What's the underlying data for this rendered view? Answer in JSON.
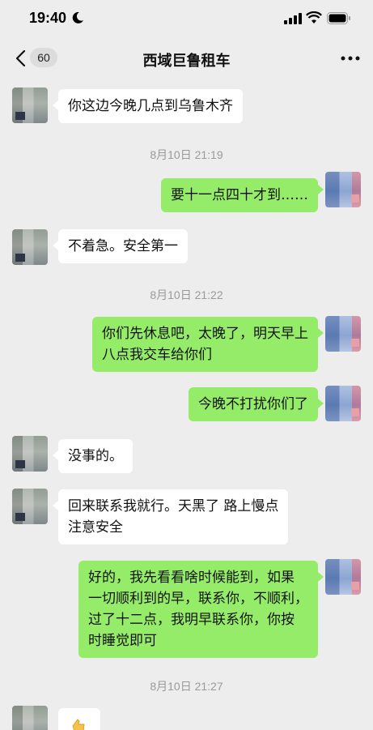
{
  "status_bar": {
    "time": "19:40",
    "icons": [
      "moon-icon",
      "signal-icon",
      "wifi-icon",
      "battery-icon"
    ]
  },
  "nav": {
    "back_icon": "chevron-left-icon",
    "unread_count": "60",
    "title": "西域巨鲁租车",
    "more_icon": "ellipsis-icon"
  },
  "colors": {
    "background": "#ededed",
    "sent_bubble": "#95ec69",
    "received_bubble": "#ffffff",
    "timestamp_text": "#9a9a9a"
  },
  "messages": [
    {
      "side": "left",
      "text": "你这边今晚几点到乌鲁木齐"
    },
    {
      "side": "timestamp",
      "text": "8月10日 21:19"
    },
    {
      "side": "right",
      "text": "要十一点四十才到……"
    },
    {
      "side": "left",
      "text": "不着急。安全第一"
    },
    {
      "side": "timestamp",
      "text": "8月10日 21:22"
    },
    {
      "side": "right",
      "text": "你们先休息吧，太晚了，明天早上\n八点我交车给你们"
    },
    {
      "side": "right",
      "text": "今晚不打扰你们了"
    },
    {
      "side": "left",
      "text": "没事的。"
    },
    {
      "side": "left",
      "text": "回来联系我就行。天黑了 路上慢点\n注意安全"
    },
    {
      "side": "right",
      "text": "好的，我先看看啥时候能到，如果\n一切顺利到的早，联系你，不顺利，\n过了十二点，我明早联系你，你按\n时睡觉即可"
    },
    {
      "side": "timestamp",
      "text": "8月10日 21:27"
    }
  ]
}
